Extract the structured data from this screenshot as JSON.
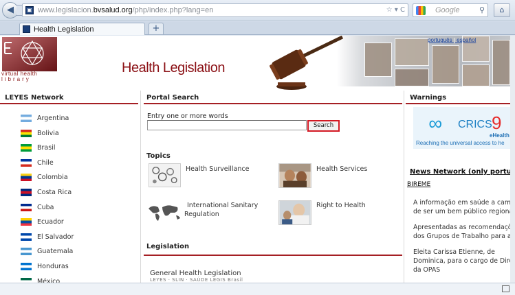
{
  "browser": {
    "url_prefix": "www.legislacion.",
    "url_domain": "bvsalud.org",
    "url_suffix": "/php/index.php?lang=en",
    "search_engine_placeholder": "Google",
    "tab_title": "Health Legislation",
    "new_tab_label": "+"
  },
  "header": {
    "logo_line1": "virtual health",
    "logo_line2": "library",
    "site_title": "Health Legislation",
    "lang_pt": "português",
    "lang_sep": "|",
    "lang_es": "español"
  },
  "left_column": {
    "title": "LEYES Network",
    "countries": [
      {
        "name": "Argentina",
        "flag": [
          "#74acdf",
          "#ffffff",
          "#74acdf"
        ]
      },
      {
        "name": "Bolivia",
        "flag": [
          "#d52b1e",
          "#f9e300",
          "#007934"
        ]
      },
      {
        "name": "Brasil",
        "flag": [
          "#009c3b",
          "#ffdf00",
          "#009c3b"
        ]
      },
      {
        "name": "Chile",
        "flag": [
          "#0033a0",
          "#ffffff",
          "#d52b1e"
        ]
      },
      {
        "name": "Colombia",
        "flag": [
          "#fcd116",
          "#003893",
          "#ce1126"
        ]
      },
      {
        "name": "Costa Rica",
        "flag": [
          "#002b7f",
          "#ce1126",
          "#002b7f"
        ]
      },
      {
        "name": "Cuba",
        "flag": [
          "#002a8f",
          "#ffffff",
          "#cb1515"
        ]
      },
      {
        "name": "Ecuador",
        "flag": [
          "#ffd100",
          "#034ea2",
          "#ef3340"
        ]
      },
      {
        "name": "El Salvador",
        "flag": [
          "#0047ab",
          "#ffffff",
          "#0047ab"
        ]
      },
      {
        "name": "Guatemala",
        "flag": [
          "#4997d0",
          "#ffffff",
          "#4997d0"
        ]
      },
      {
        "name": "Honduras",
        "flag": [
          "#0073cf",
          "#ffffff",
          "#0073cf"
        ]
      },
      {
        "name": "México",
        "flag": [
          "#006847",
          "#ffffff",
          "#ce1126"
        ]
      }
    ]
  },
  "center_column": {
    "title": "Portal Search",
    "search_label": "Entry one or more words",
    "search_value": "",
    "search_button": "Search",
    "topics_title": "Topics",
    "topics": [
      {
        "label": "Health Surveillance"
      },
      {
        "label": "Health Services"
      },
      {
        "label_line1": "International Sanitary",
        "label_line2": "Regulation"
      },
      {
        "label": "Right to Health"
      }
    ],
    "legislation_title": "Legislation",
    "general_legislation": "General Health Legislation",
    "general_legislation_sub": "LEYES · SLIN · SAÚDE LEGIS Brasil"
  },
  "right_column": {
    "title": "Warnings",
    "banner": {
      "wordmark": "CRICS",
      "number": "9",
      "subtitle": "eHealth",
      "tagline": "Reaching the universal access to he"
    },
    "news_network_title": "News Network (only portugues",
    "bireme_link": "BIREME",
    "news": [
      {
        "line1": "A informação em saúde a camin",
        "line2": "de ser um bem público regional"
      },
      {
        "line1": "Apresentadas as recomendaçõe",
        "line2": "dos Grupos de Trabalho para a"
      },
      {
        "line1": "Eleita Carissa Etienne, de",
        "line2": "Dominica, para o cargo de Direto",
        "line3": "da OPAS"
      }
    ]
  },
  "colors": {
    "brand_red": "#8b1015",
    "rule_red": "#a51f24",
    "highlight_red": "#d31823",
    "link_blue": "#1a44a0"
  }
}
